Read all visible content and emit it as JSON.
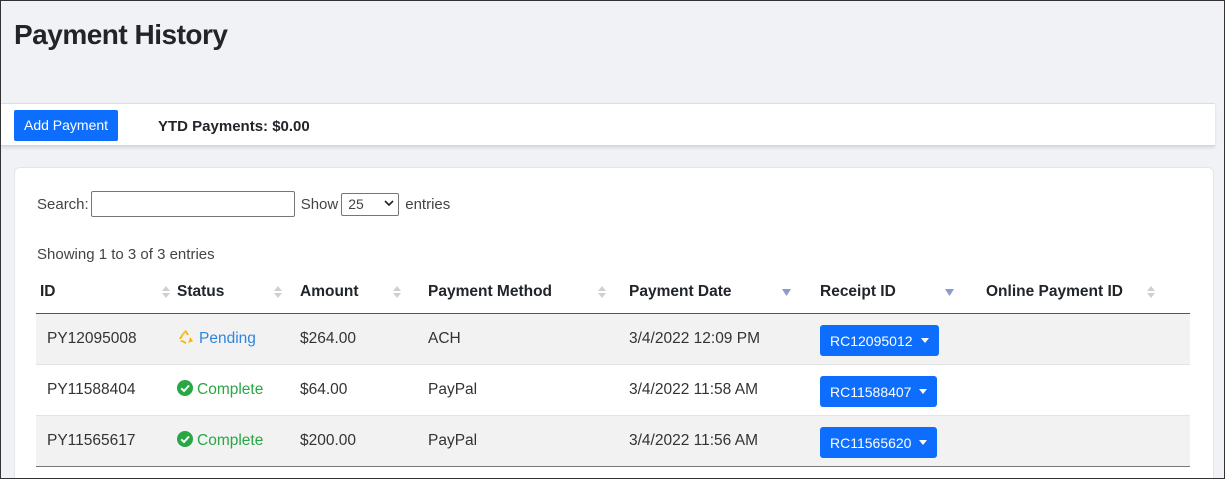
{
  "page": {
    "title": "Payment History"
  },
  "toolbar": {
    "add_payment_label": "Add Payment",
    "ytd_label": "YTD Payments: $0.00"
  },
  "controls": {
    "search_label": "Search:",
    "search_value": "",
    "show_label": "Show",
    "entries_value": "25",
    "entries_label": "entries"
  },
  "info": "Showing 1 to 3 of 3 entries",
  "table": {
    "columns": [
      {
        "label": "ID",
        "sort": "both"
      },
      {
        "label": "Status",
        "sort": "both"
      },
      {
        "label": "Amount",
        "sort": "both"
      },
      {
        "label": "Payment Method",
        "sort": "both"
      },
      {
        "label": "Payment Date",
        "sort": "desc"
      },
      {
        "label": "Receipt ID",
        "sort": "desc"
      },
      {
        "label": "Online Payment ID",
        "sort": "both"
      }
    ],
    "rows": [
      {
        "id": "PY12095008",
        "status": "Pending",
        "status_type": "pending",
        "amount": "$264.00",
        "method": "ACH",
        "date": "3/4/2022 12:09 PM",
        "receipt": "RC12095012",
        "online_id": ""
      },
      {
        "id": "PY11588404",
        "status": "Complete",
        "status_type": "complete",
        "amount": "$64.00",
        "method": "PayPal",
        "date": "3/4/2022 11:58 AM",
        "receipt": "RC11588407",
        "online_id": ""
      },
      {
        "id": "PY11565617",
        "status": "Complete",
        "status_type": "complete",
        "amount": "$200.00",
        "method": "PayPal",
        "date": "3/4/2022 11:56 AM",
        "receipt": "RC11565620",
        "online_id": ""
      }
    ]
  },
  "colors": {
    "primary": "#0d6efd",
    "pending": "#2e86de",
    "complete": "#28a745",
    "header_bg": "#f1f2f6"
  },
  "icons": {
    "pending": "recycle-icon",
    "complete": "check-circle-icon",
    "sort_both": "sort-icon",
    "sort_desc": "sort-desc-icon",
    "dropdown": "caret-down-icon"
  }
}
